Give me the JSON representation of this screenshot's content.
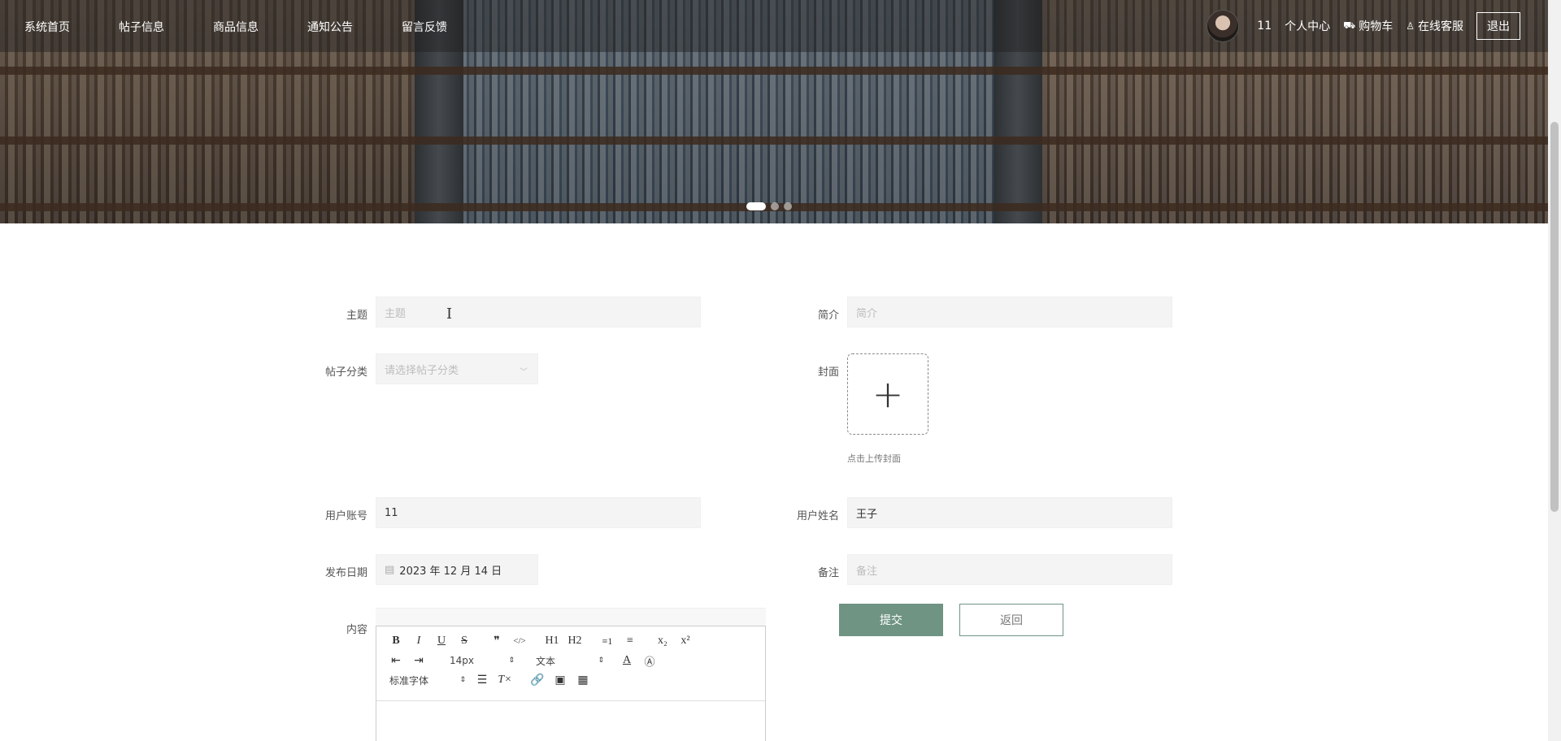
{
  "nav": {
    "items": [
      "系统首页",
      "帖子信息",
      "商品信息",
      "通知公告",
      "留言反馈"
    ],
    "user_name": "11",
    "personal_center": "个人中心",
    "cart": "购物车",
    "customer_service": "在线客服",
    "logout": "退出"
  },
  "banner": {
    "slides": 3,
    "active_slide": 1
  },
  "form": {
    "title_label": "主题",
    "title_placeholder": "主题",
    "intro_label": "简介",
    "intro_placeholder": "简介",
    "category_label": "帖子分类",
    "category_placeholder": "请选择帖子分类",
    "cover_label": "封面",
    "cover_upload_icon": "+",
    "cover_hint": "点击上传封面",
    "account_label": "用户账号",
    "account_value": "11",
    "username_label": "用户姓名",
    "username_value": "王子",
    "date_label": "发布日期",
    "date_value": "2023 年 12 月 14 日",
    "remark_label": "备注",
    "remark_placeholder": "备注",
    "content_label": "内容",
    "submit": "提交",
    "back": "返回"
  },
  "editor": {
    "row1": [
      "B",
      "I",
      "U",
      "S",
      "❞",
      "</>",
      "H1",
      "H2",
      "≡1",
      "≡",
      "x₂",
      "x²"
    ],
    "font_size": "14px",
    "block_type": "文本",
    "font_family": "标准字体"
  },
  "colors": {
    "accent": "#6f9484",
    "nav_bg": "rgba(30,30,30,0.45)"
  }
}
